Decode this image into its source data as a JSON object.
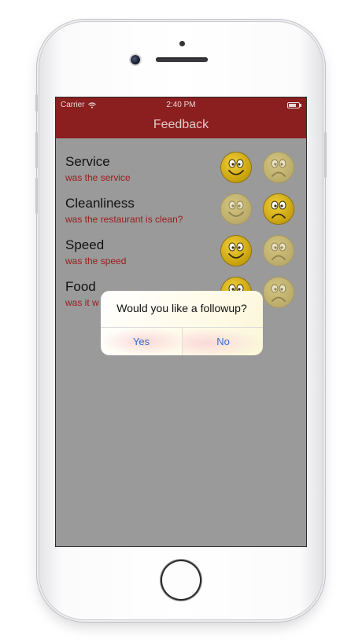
{
  "status_bar": {
    "carrier": "Carrier",
    "time": "2:40 PM",
    "icons": [
      "wifi-icon",
      "battery-icon"
    ]
  },
  "navbar": {
    "title": "Feedback",
    "color": "#8b1e1e"
  },
  "feedback_items": [
    {
      "title": "Service",
      "subtitle": "was the service",
      "selected": "happy"
    },
    {
      "title": "Cleanliness",
      "subtitle": "was the restaurant is clean?",
      "selected": "sad"
    },
    {
      "title": "Speed",
      "subtitle": "was the speed",
      "selected": "happy"
    },
    {
      "title": "Food",
      "subtitle": "was it w",
      "selected": "happy"
    }
  ],
  "alert": {
    "message": "Would you like a followup?",
    "yes_label": "Yes",
    "no_label": "No"
  },
  "colors": {
    "accent_link": "#2f6fd6",
    "subtitle_red": "#9a1c1c",
    "face_yellow": "#c7a10c"
  }
}
